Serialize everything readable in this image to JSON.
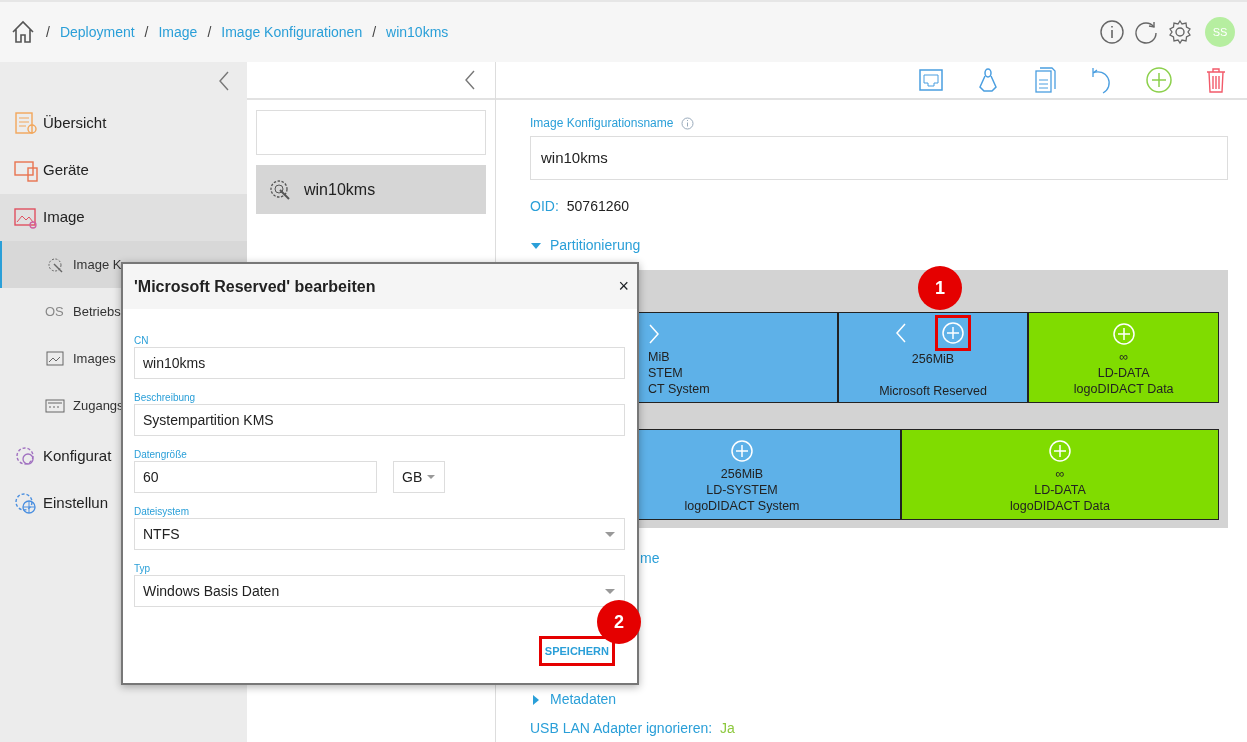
{
  "breadcrumb": {
    "separator": "/",
    "items": [
      "Deployment",
      "Image",
      "Image Konfigurationen",
      "win10kms"
    ]
  },
  "user": {
    "initials": "SS"
  },
  "sidebar": {
    "items": [
      {
        "label": "Übersicht",
        "selected": false
      },
      {
        "label": "Geräte",
        "selected": false
      },
      {
        "label": "Image",
        "selected": true,
        "children": [
          {
            "label": "Image K",
            "selected": true
          },
          {
            "label": "Betriebs",
            "icon_text": "OS",
            "selected": false
          },
          {
            "label": "Images",
            "selected": false
          },
          {
            "label": "Zugangs",
            "selected": false
          }
        ]
      },
      {
        "label": "Konfigurat",
        "selected": false
      },
      {
        "label": "Einstellun",
        "selected": false
      }
    ]
  },
  "list": {
    "items": [
      {
        "label": "win10kms",
        "selected": true
      }
    ]
  },
  "form": {
    "name_label": "Image Konfigurationsname",
    "name_value": "win10kms",
    "oid_label": "OID:",
    "oid_value": "50761260",
    "partition_section": {
      "label": "Partitionierung",
      "expanded": true
    },
    "partition_rows": [
      [
        {
          "size": "MiB",
          "name": "STEM",
          "label": "CT System",
          "color": "#5eb1e8",
          "can_move_left": false,
          "can_move_right": true,
          "can_add": false
        },
        {
          "size": "256MiB",
          "label": "Microsoft Reserved",
          "color": "#5eb1e8",
          "can_move_left": true,
          "can_move_right": false,
          "can_add": true
        },
        {
          "size": "∞",
          "name": "LD-DATA",
          "label": "logoDIDACT Data",
          "color": "#80dc00",
          "can_move_left": false,
          "can_move_right": false,
          "can_add": true
        }
      ],
      [
        {
          "size": "256MiB",
          "name": "LD-SYSTEM",
          "label": "logoDIDACT System",
          "color": "#5eb1e8",
          "can_move_left": false,
          "can_move_right": false,
          "can_add": true
        },
        {
          "size": "∞",
          "name": "LD-DATA",
          "label": "logoDIDACT Data",
          "color": "#80dc00",
          "can_move_left": false,
          "can_move_right": false,
          "can_add": true
        }
      ]
    ],
    "partial_link": "me",
    "metadata_section": {
      "label": "Metadaten",
      "expanded": false
    },
    "usb_label": "USB LAN Adapter ignorieren:",
    "usb_value": "Ja"
  },
  "dialog": {
    "title": "'Microsoft Reserved' bearbeiten",
    "close": "×",
    "fields": [
      {
        "kind": "text",
        "label": "CN",
        "value": "win10kms"
      },
      {
        "kind": "text",
        "label": "Beschreibung",
        "value": "Systempartition KMS"
      },
      {
        "kind": "size",
        "label": "Datengröße",
        "value": "60",
        "unit": "GB"
      },
      {
        "kind": "select",
        "label": "Dateisystem",
        "value": "NTFS"
      },
      {
        "kind": "select",
        "label": "Typ",
        "value": "Windows Basis Daten"
      }
    ],
    "save_button": "SPEICHERN"
  },
  "callouts": [
    {
      "number": "1"
    },
    {
      "number": "2"
    }
  ]
}
